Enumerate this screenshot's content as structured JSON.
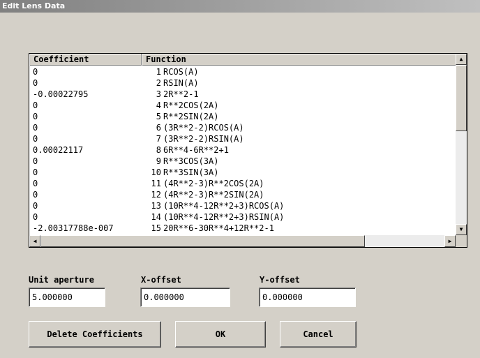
{
  "window": {
    "title": "Edit Lens Data"
  },
  "table": {
    "headers": {
      "coefficient": "Coefficient",
      "function": "Function"
    },
    "rows": [
      {
        "coef": "0",
        "num": "1",
        "func": "RCOS(A)"
      },
      {
        "coef": "0",
        "num": "2",
        "func": "RSIN(A)"
      },
      {
        "coef": "-0.00022795",
        "num": "3",
        "func": "2R**2-1"
      },
      {
        "coef": "0",
        "num": "4",
        "func": "R**2COS(2A)"
      },
      {
        "coef": "0",
        "num": "5",
        "func": "R**2SIN(2A)"
      },
      {
        "coef": "0",
        "num": "6",
        "func": "(3R**2-2)RCOS(A)"
      },
      {
        "coef": "0",
        "num": "7",
        "func": "(3R**2-2)RSIN(A)"
      },
      {
        "coef": "0.00022117",
        "num": "8",
        "func": "6R**4-6R**2+1"
      },
      {
        "coef": "0",
        "num": "9",
        "func": "R**3COS(3A)"
      },
      {
        "coef": "0",
        "num": "10",
        "func": "R**3SIN(3A)"
      },
      {
        "coef": "0",
        "num": "11",
        "func": "(4R**2-3)R**2COS(2A)"
      },
      {
        "coef": "0",
        "num": "12",
        "func": "(4R**2-3)R**2SIN(2A)"
      },
      {
        "coef": "0",
        "num": "13",
        "func": "(10R**4-12R**2+3)RCOS(A)"
      },
      {
        "coef": "0",
        "num": "14",
        "func": "(10R**4-12R**2+3)RSIN(A)"
      },
      {
        "coef": "-2.00317788e-007",
        "num": "15",
        "func": "20R**6-30R**4+12R**2-1"
      }
    ]
  },
  "fields": {
    "unit_aperture": {
      "label": "Unit aperture",
      "value": "5.000000"
    },
    "x_offset": {
      "label": "X-offset",
      "value": "0.000000"
    },
    "y_offset": {
      "label": "Y-offset",
      "value": "0.000000"
    }
  },
  "buttons": {
    "delete": "Delete Coefficients",
    "ok": "OK",
    "cancel": "Cancel"
  },
  "icons": {
    "scroll_up": "up-arrow-icon",
    "scroll_down": "down-arrow-icon",
    "scroll_left": "left-arrow-icon",
    "scroll_right": "right-arrow-icon"
  }
}
